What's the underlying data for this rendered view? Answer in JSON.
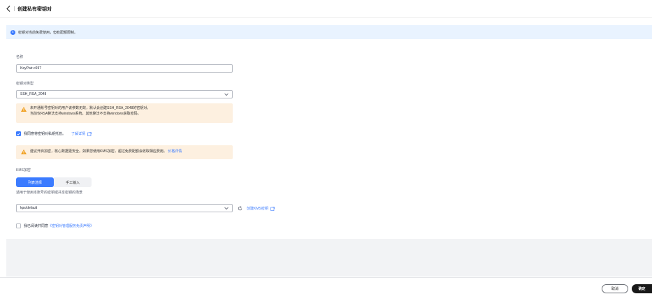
{
  "header": {
    "title": "创建私有密钥对"
  },
  "info_banner": {
    "text": "密钥对当前免费使用，但有配额限制。"
  },
  "form": {
    "name_label": "名称",
    "name_value": "KeyPair-c697",
    "type_label": "密钥对类型",
    "type_value": "SSH_RSA_2048",
    "type_warning_line1": "未开通账号密钥对的用户该参数无效，默认会创建SSH_RSA_2048的密钥对。",
    "type_warning_line2": "当前仅RSA算法支持windows系统，其他算法不支持windows获取密码。",
    "custody_checkbox_label": "我同意将密钥对私钥托管。",
    "custody_checked": true,
    "learn_more_link": "了解详情",
    "custody_warning_text": "建议开启加密，核心数据更安全。如果您使用KMS加密，超过免费配额会收取相应费用。",
    "pricing_link": "价格详情",
    "kms_label": "KMS加密",
    "kms_tabs": [
      {
        "label": "列表选择",
        "active": true
      },
      {
        "label": "手工输入",
        "active": false
      }
    ],
    "kms_hint": "适用于使用本账号的密钥或共享密钥的场景",
    "kms_value": "kps/default",
    "create_kms_link": "创建KMS密钥",
    "agreement_prefix": "我已阅读并同意",
    "agreement_link": "《密钥对管理服务免责声明》",
    "agreement_checked": false
  },
  "footer": {
    "cancel_label": "取消",
    "confirm_label": "确定"
  },
  "colors": {
    "accent": "#3b7bff",
    "warning_bg": "#fdf0e0",
    "warning_icon": "#f0a020",
    "info_bg": "#e9f3ff"
  }
}
